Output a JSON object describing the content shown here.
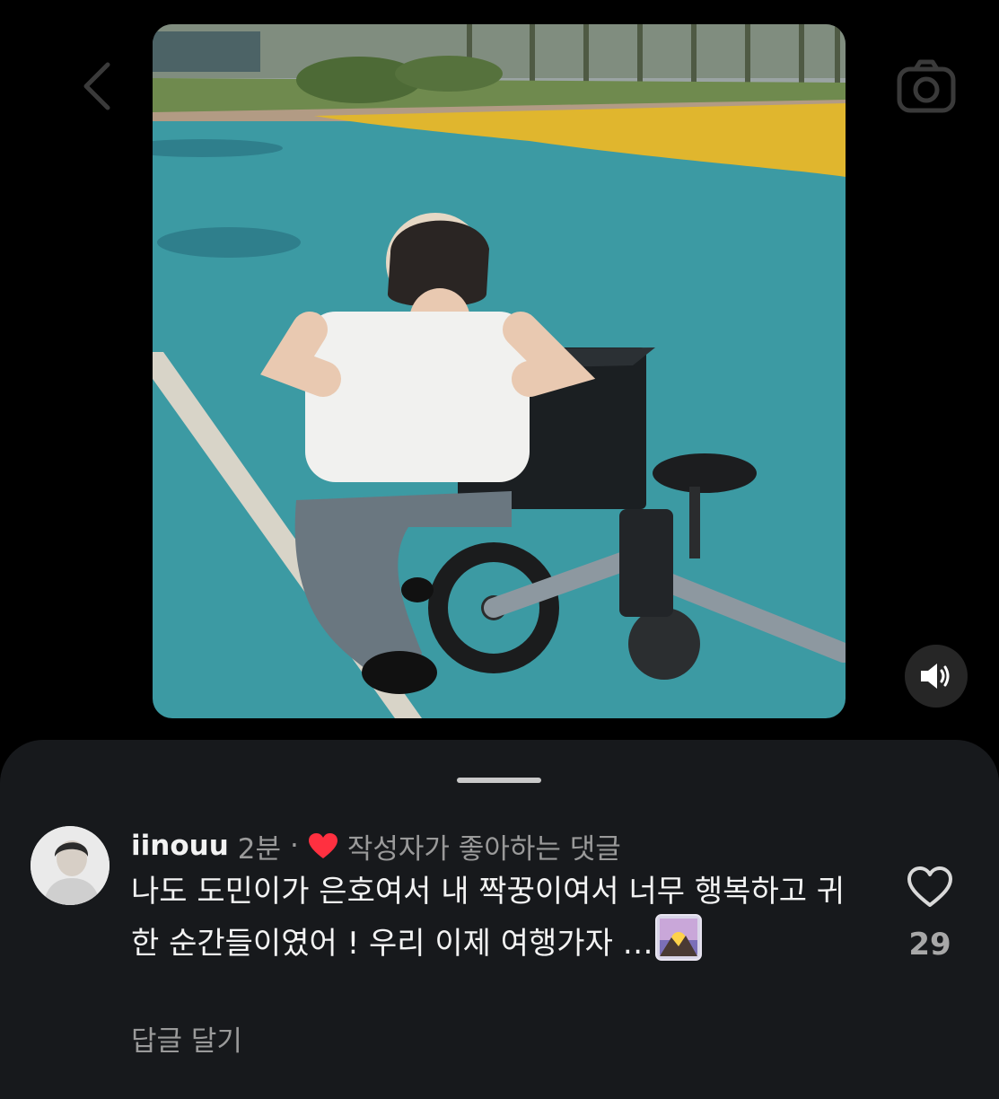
{
  "post": {
    "icons": {
      "back": "chevron-left-icon",
      "camera": "camera-icon",
      "sound": "sound-on-icon"
    }
  },
  "comments_sheet": {
    "comment": {
      "username": "iinouu",
      "time": "2분",
      "separator": "·",
      "liked_by_author_label": "작성자가 좋아하는 댓글",
      "text": "나도 도민이가 은호여서 내 짝꿍이여서 너무 행복하고 귀한 순간들이였어 ! 우리 이제 여행가자 …",
      "emoji": "sunrise-over-mountains",
      "reply_label": "답글 달기",
      "like_count": "29"
    }
  },
  "colors": {
    "background": "#000000",
    "sheet": "#17191c",
    "heart_red": "#ff3040",
    "muted_text": "#9a9a9a"
  }
}
